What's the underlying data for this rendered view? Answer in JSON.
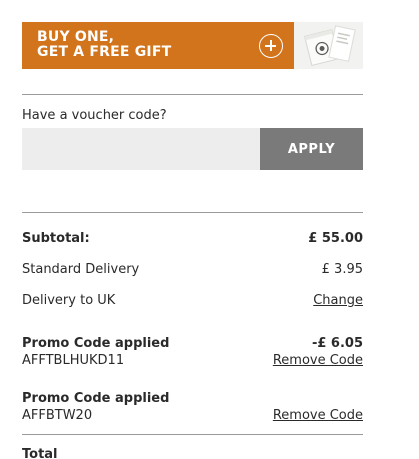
{
  "promo": {
    "line1": "BUY ONE,",
    "line2": "GET A FREE GIFT"
  },
  "voucher": {
    "label": "Have a voucher code?",
    "input_value": "",
    "apply_label": "APPLY"
  },
  "summary": {
    "subtotal_label": "Subtotal:",
    "subtotal_value": "£ 55.00",
    "delivery_label": "Standard Delivery",
    "delivery_value": "£ 3.95",
    "delivery_to_label": "Delivery to UK",
    "change_label": "Change",
    "promo1_title": "Promo Code applied",
    "promo1_code": "AFFTBLHUKD11",
    "promo1_value": "-£ 6.05",
    "promo1_remove": "Remove Code",
    "promo2_title": "Promo Code applied",
    "promo2_code": "AFFBTW20",
    "promo2_remove": "Remove Code",
    "total_label": "Total"
  }
}
